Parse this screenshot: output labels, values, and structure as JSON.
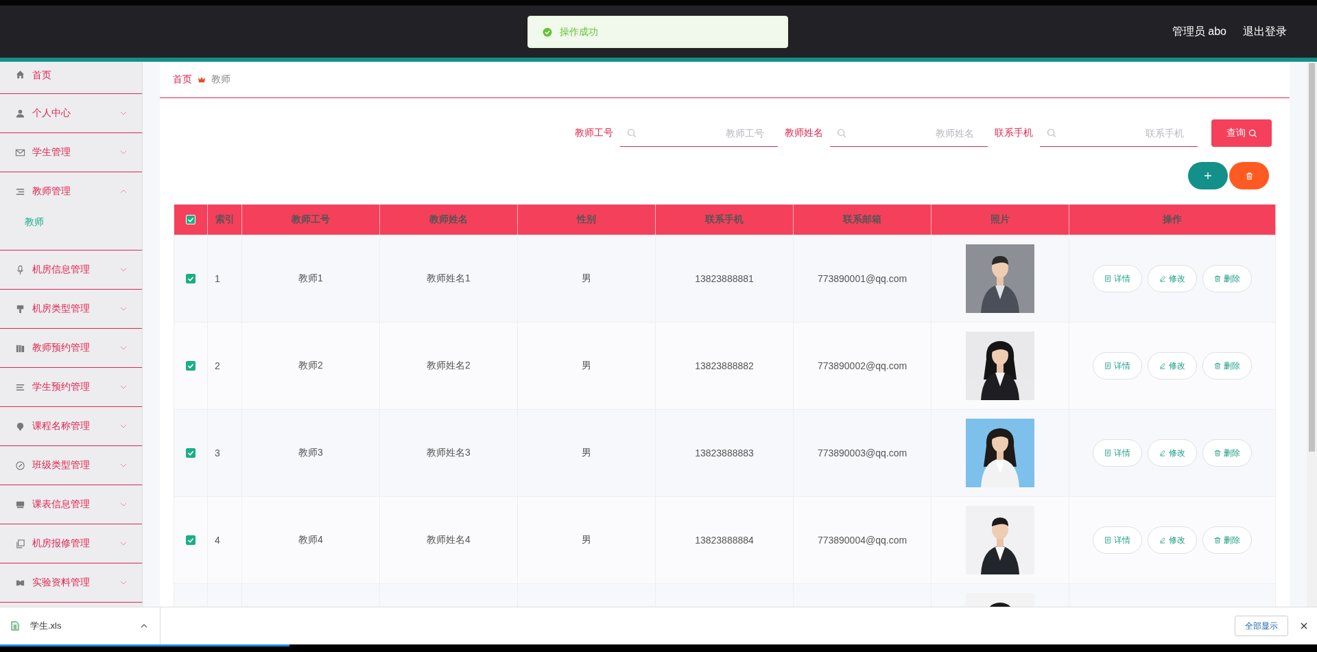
{
  "toast": {
    "text": "操作成功"
  },
  "header": {
    "user": "管理员 abo",
    "logout": "退出登录"
  },
  "sidebar": {
    "items": [
      {
        "label": "首页",
        "kind": "link"
      },
      {
        "label": "个人中心",
        "kind": "menu",
        "expanded": false
      },
      {
        "label": "学生管理",
        "kind": "menu",
        "expanded": false
      },
      {
        "label": "教师管理",
        "kind": "menu",
        "expanded": true,
        "children": [
          {
            "label": "教师",
            "selected": true
          }
        ]
      },
      {
        "label": "机房信息管理",
        "kind": "menu",
        "expanded": false
      },
      {
        "label": "机房类型管理",
        "kind": "menu",
        "expanded": false
      },
      {
        "label": "教师预约管理",
        "kind": "menu",
        "expanded": false
      },
      {
        "label": "学生预约管理",
        "kind": "menu",
        "expanded": false
      },
      {
        "label": "课程名称管理",
        "kind": "menu",
        "expanded": false
      },
      {
        "label": "班级类型管理",
        "kind": "menu",
        "expanded": false
      },
      {
        "label": "课表信息管理",
        "kind": "menu",
        "expanded": false
      },
      {
        "label": "机房报修管理",
        "kind": "menu",
        "expanded": false
      },
      {
        "label": "实验资料管理",
        "kind": "menu",
        "expanded": false
      }
    ]
  },
  "breadcrumb": [
    "首页",
    "教师"
  ],
  "search": {
    "fields": [
      {
        "label": "教师工号",
        "placeholder": "教师工号"
      },
      {
        "label": "教师姓名",
        "placeholder": "教师姓名"
      },
      {
        "label": "联系手机",
        "placeholder": "联系手机"
      }
    ],
    "button": "查询"
  },
  "table": {
    "all_checked": true,
    "columns": [
      "索引",
      "教师工号",
      "教师姓名",
      "性别",
      "联系手机",
      "联系邮箱",
      "照片",
      "操作"
    ],
    "rows": [
      {
        "kind": "full",
        "checked": true,
        "cells": [
          "1",
          "教师1",
          "教师姓名1",
          "男",
          "13823888881",
          "773890001@qq.com"
        ],
        "actions": [
          "详情",
          "修改",
          "删除"
        ]
      },
      {
        "kind": "full",
        "checked": true,
        "cells": [
          "2",
          "教师2",
          "教师姓名2",
          "男",
          "13823888882",
          "773890002@qq.com"
        ],
        "actions": [
          "详情",
          "修改",
          "删除"
        ]
      },
      {
        "kind": "full",
        "checked": true,
        "cells": [
          "3",
          "教师3",
          "教师姓名3",
          "男",
          "13823888883",
          "773890003@qq.com"
        ],
        "actions": [
          "详情",
          "修改",
          "删除"
        ]
      },
      {
        "kind": "full",
        "checked": true,
        "cells": [
          "4",
          "教师4",
          "教师姓名4",
          "男",
          "13823888884",
          "773890004@qq.com"
        ],
        "actions": [
          "详情",
          "修改",
          "删除"
        ]
      },
      {
        "kind": "partial"
      }
    ]
  },
  "download_bar": {
    "file": "学生.xls",
    "show_all": "全部显示"
  },
  "progress": {
    "level": 0.22
  }
}
